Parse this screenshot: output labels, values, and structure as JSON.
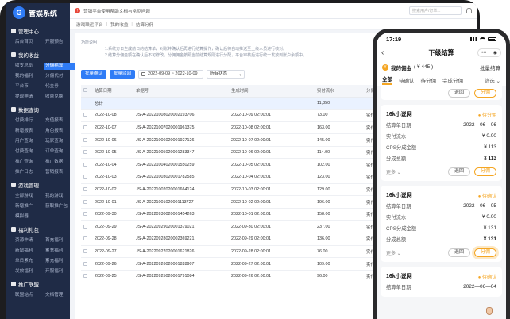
{
  "brand": {
    "name": "管娱系统",
    "logo_char": "G"
  },
  "sidebar": {
    "sections": [
      {
        "title": "管理中心",
        "items": [
          "后台首页",
          "开服预告"
        ]
      },
      {
        "title": "我的收益",
        "items": [
          "收支总览",
          "分佣结算",
          "我的福利",
          "分佣代付",
          "平台币",
          "代金券",
          "提现申请",
          "收益兑换"
        ],
        "active": "分佣结算"
      },
      {
        "title": "数据查询",
        "items": [
          "付费排行",
          "充值报表",
          "新增报表",
          "角色报表",
          "用户查询",
          "玩家查询",
          "付费查询",
          "订单查询",
          "推广查询",
          "推广数据",
          "推广日志",
          "营销报表"
        ]
      },
      {
        "title": "游戏管理",
        "items": [
          "全部游戏",
          "我的游戏",
          "新增推广",
          "获取推广包",
          "模拟器"
        ]
      },
      {
        "title": "福利礼包",
        "items": [
          "资源申请",
          "首充福利",
          "新增福利",
          "累充福利",
          "单日累充",
          "累充福利",
          "发放福利",
          "开服福利"
        ]
      },
      {
        "title": "推广联盟",
        "items": [
          "联盟站点",
          "文档管理"
        ]
      }
    ]
  },
  "topbar": {
    "notice": "营销平台使用帮助文档与常见问题",
    "search_placeholder": "搜索用户/订单..."
  },
  "breadcrumb": [
    "游戏联运平台",
    "我的收益",
    "结算分佣"
  ],
  "panel": {
    "desc_title": "功能说明",
    "desc_lines": [
      "1.系统方日生成前日的结算单，对账并确认后再进行结算操作，确认后将自动推送至上级人员进行核对。",
      "2.结算分佣金额在确认后不可修改，分佣佣金按照当前结算规则进行分配，平台审核后进行统一发放到账户余额中。"
    ],
    "btn_confirm": "批量确认",
    "btn_reject": "批量驳回",
    "date_range": "2022-09-09 ~ 2022-10-09",
    "status_select": "所有状态"
  },
  "table": {
    "headers": [
      "",
      "结算日期",
      "单据号",
      "生成时间",
      "实付流水",
      "分佣方式",
      ""
    ],
    "total_label": "总计",
    "total_amount": "11,350",
    "rows": [
      [
        "2022-10-08",
        "JS-A-20221008020002193706",
        "2022-10-09 02:00:01",
        "73.00",
        "实付金额"
      ],
      [
        "2022-10-07",
        "JS-A-20221007020001961375",
        "2022-10-08 02:00:01",
        "163.00",
        "实付金额"
      ],
      [
        "2022-10-06",
        "JS-A-20221006020001927126",
        "2022-10-07 02:00:01",
        "145.00",
        "实付金额"
      ],
      [
        "2022-10-05",
        "JS-A-20221005020001283347",
        "2022-10-06 02:00:01",
        "114.00",
        "实付金额"
      ],
      [
        "2022-10-04",
        "JS-A-20221004020001550259",
        "2022-10-05 02:00:01",
        "102.00",
        "实付金额"
      ],
      [
        "2022-10-03",
        "JS-A-20221003020001782585",
        "2022-10-04 02:00:01",
        "123.00",
        "实付金额"
      ],
      [
        "2022-10-02",
        "JS-A-20221002020001664124",
        "2022-10-03 02:00:01",
        "129.00",
        "实付金额"
      ],
      [
        "2022-10-01",
        "JS-A-20221001020001113727",
        "2022-10-02 02:00:01",
        "196.00",
        "实付金额"
      ],
      [
        "2022-09-30",
        "JS-A-20220930020001454263",
        "2022-10-01 02:00:01",
        "158.00",
        "实付金额"
      ],
      [
        "2022-09-29",
        "JS-A-20220929020001379021",
        "2022-09-30 02:00:01",
        "237.00",
        "实付金额"
      ],
      [
        "2022-09-28",
        "JS-A-20220928020002369221",
        "2022-09-29 02:00:01",
        "136.00",
        "实付金额"
      ],
      [
        "2022-09-27",
        "JS-A-20220927020001621826",
        "2022-09-28 02:00:01",
        "76.00",
        "实付金额"
      ],
      [
        "2022-09-26",
        "JS-A-20220926020001828907",
        "2022-09-27 02:00:01",
        "109.00",
        "实付金额"
      ],
      [
        "2022-09-25",
        "JS-A-20220925020001791084",
        "2022-09-26 02:00:01",
        "96.00",
        "实付金额"
      ]
    ]
  },
  "phone": {
    "time": "17:19",
    "title": "下级结算",
    "capsule_dots": "•••",
    "capsule_close": "◉",
    "summary_label": "我的佣金",
    "summary_amount": "( ¥ 445 )",
    "batch": "批量结算",
    "tabs": [
      "全部",
      "待确认",
      "待分佣",
      "完成分佣"
    ],
    "filter": "筛选 ⌄",
    "btn_reject": "退回",
    "btn_split": "分佣",
    "more": "更多 ⌄",
    "cards": [
      {
        "name": "16k小说网",
        "status": "● 待分佣",
        "rows": [
          [
            "结算单日期",
            "2022—06—06"
          ],
          [
            "实付流水",
            "¥ 0.00"
          ],
          [
            "CPS分成金额",
            "¥ 113"
          ],
          [
            "分成总额",
            "¥ 113"
          ]
        ]
      },
      {
        "name": "16k小说网",
        "status": "● 待确认",
        "rows": [
          [
            "结算单日期",
            "2022—06—05"
          ],
          [
            "实付流水",
            "¥ 0.00"
          ],
          [
            "CPS分成金额",
            "¥ 131"
          ],
          [
            "分成总额",
            "¥ 131"
          ]
        ]
      },
      {
        "name": "16k小说网",
        "status": "● 待确认",
        "rows": [
          [
            "结算单日期",
            "2022—06—04"
          ]
        ]
      }
    ]
  }
}
